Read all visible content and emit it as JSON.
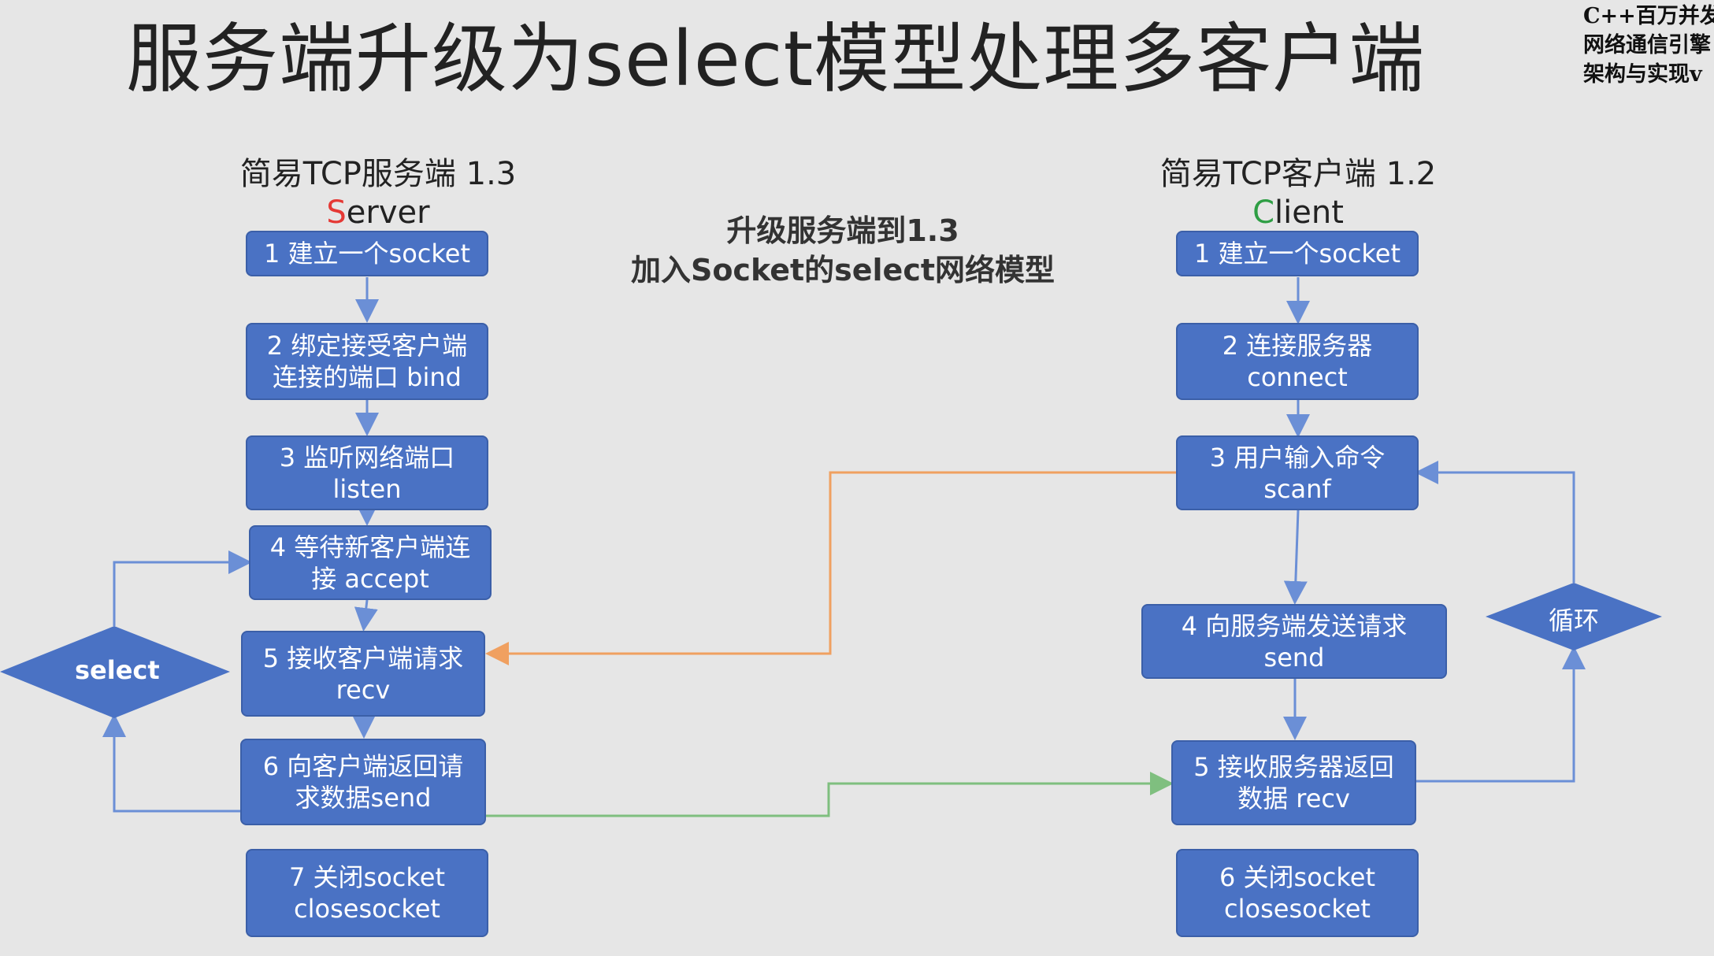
{
  "title": "服务端升级为select模型处理多客户端",
  "corner_text": [
    "C++百万并发",
    "网络通信引擎",
    "架构与实现v"
  ],
  "server": {
    "heading": "简易TCP服务端 1.3",
    "role_first": "S",
    "role_rest": "erver",
    "steps": [
      [
        "1 建立一个socket"
      ],
      [
        "2 绑定接受客户端",
        "连接的端口 bind"
      ],
      [
        "3 监听网络端口",
        "listen"
      ],
      [
        "4 等待新客户端连",
        "接 accept"
      ],
      [
        "5 接收客户端请求",
        "recv"
      ],
      [
        "6 向客户端返回请",
        "求数据send"
      ],
      [
        "7 关闭socket",
        "closesocket"
      ]
    ],
    "diamond": "select"
  },
  "middle": {
    "line1": "升级服务端到1.3",
    "line2": "加入Socket的select网络模型"
  },
  "client": {
    "heading": "简易TCP客户端 1.2",
    "role_first": "C",
    "role_rest": "lient",
    "steps": [
      [
        "1 建立一个socket"
      ],
      [
        "2 连接服务器",
        "connect"
      ],
      [
        "3 用户输入命令",
        "scanf"
      ],
      [
        "4 向服务端发送请求",
        "send"
      ],
      [
        "5 接收服务器返回",
        "数据 recv"
      ],
      [
        "6 关闭socket",
        "closesocket"
      ]
    ],
    "diamond": "循环"
  },
  "colors": {
    "box_fill": "#4a72c4",
    "arrow_blue": "#6b8fd6",
    "arrow_orange": "#f0a060",
    "arrow_green": "#7fbf7f"
  }
}
